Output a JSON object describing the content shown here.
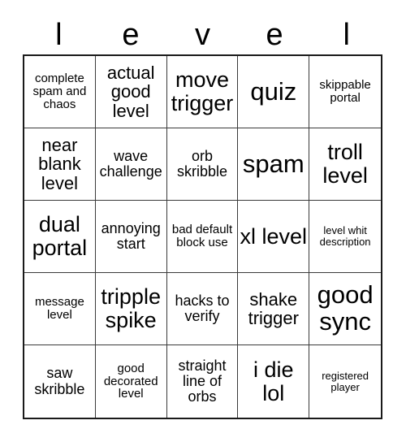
{
  "card": {
    "header_letters": [
      "l",
      "e",
      "v",
      "e",
      "l"
    ],
    "header_word": "level",
    "columns": 5,
    "rows": 5,
    "colors": {
      "background": "#ffffff",
      "text": "#000000",
      "outer_border": "#1a1a1a",
      "inner_border": "#3a3a3a"
    },
    "cells": [
      {
        "text": "complete spam and chaos",
        "size": "fs-s"
      },
      {
        "text": "actual good level",
        "size": "fs-l"
      },
      {
        "text": "move trigger",
        "size": "fs-xl"
      },
      {
        "text": "quiz",
        "size": "fs-xxl"
      },
      {
        "text": "skippable portal",
        "size": "fs-s"
      },
      {
        "text": "near blank level",
        "size": "fs-l"
      },
      {
        "text": "wave challenge",
        "size": "fs-m"
      },
      {
        "text": "orb skribble",
        "size": "fs-m"
      },
      {
        "text": "spam",
        "size": "fs-xxl"
      },
      {
        "text": "troll level",
        "size": "fs-xl"
      },
      {
        "text": "dual portal",
        "size": "fs-xl"
      },
      {
        "text": "annoying start",
        "size": "fs-m"
      },
      {
        "text": "bad default block use",
        "size": "fs-s"
      },
      {
        "text": "xl level",
        "size": "fs-xl"
      },
      {
        "text": "level whit description",
        "size": "fs-xs"
      },
      {
        "text": "message level",
        "size": "fs-s"
      },
      {
        "text": "tripple spike",
        "size": "fs-xl"
      },
      {
        "text": "hacks to verify",
        "size": "fs-m"
      },
      {
        "text": "shake trigger",
        "size": "fs-l"
      },
      {
        "text": "good sync",
        "size": "fs-xxl"
      },
      {
        "text": "saw skribble",
        "size": "fs-m"
      },
      {
        "text": "good decorated level",
        "size": "fs-s"
      },
      {
        "text": "straight line of orbs",
        "size": "fs-m"
      },
      {
        "text": "i die lol",
        "size": "fs-xl"
      },
      {
        "text": "registered player",
        "size": "fs-xs"
      }
    ]
  }
}
